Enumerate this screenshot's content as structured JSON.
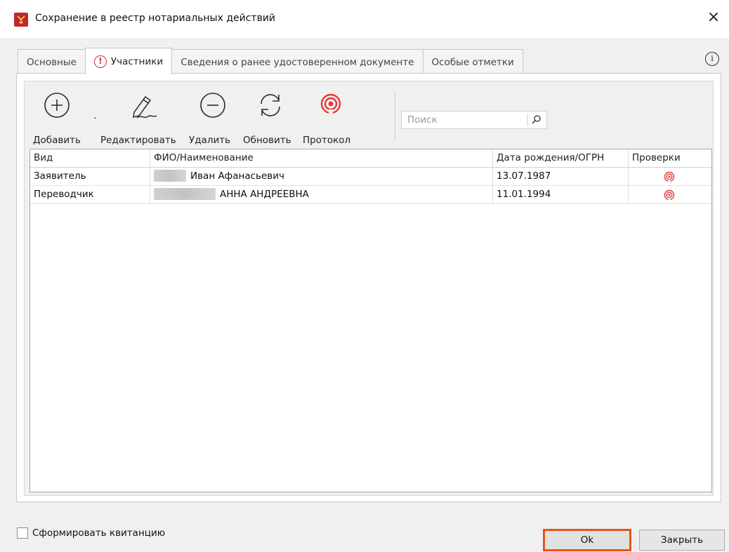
{
  "window": {
    "title": "Сохранение в реестр нотариальных действий",
    "close_glyph": "×"
  },
  "tabs": [
    {
      "label": "Основные",
      "active": false
    },
    {
      "label": "Участники",
      "active": true,
      "icon": "warning-icon"
    },
    {
      "label": "Сведения о ранее удостоверенном документе",
      "active": false
    },
    {
      "label": "Особые отметки",
      "active": false
    }
  ],
  "info_glyph": "i",
  "warning_glyph": "!",
  "toolbar": {
    "add_label": "Добавить",
    "edit_label": "Редактировать",
    "delete_label": "Удалить",
    "refresh_label": "Обновить",
    "protocol_label": "Протокол"
  },
  "search": {
    "placeholder": "Поиск",
    "value": ""
  },
  "table": {
    "columns": [
      "Вид",
      "ФИО/Наименование",
      "Дата рождения/ОГРН",
      "Проверки"
    ],
    "rows": [
      {
        "kind": "Заявитель",
        "name": "Иван Афанасьевич",
        "date": "13.07.1987",
        "check_icon": "signal-icon"
      },
      {
        "kind": "Переводчик",
        "name": "АННА АНДРЕЕВНА",
        "date": "11.01.1994",
        "check_icon": "signal-icon"
      }
    ]
  },
  "footer": {
    "receipt_label": "Сформировать квитанцию",
    "receipt_checked": false,
    "ok_label": "Ok",
    "close_label": "Закрыть"
  },
  "colors": {
    "accent_red": "#d0342c",
    "ok_border": "#e8541b",
    "app_icon": "#c0272d"
  }
}
